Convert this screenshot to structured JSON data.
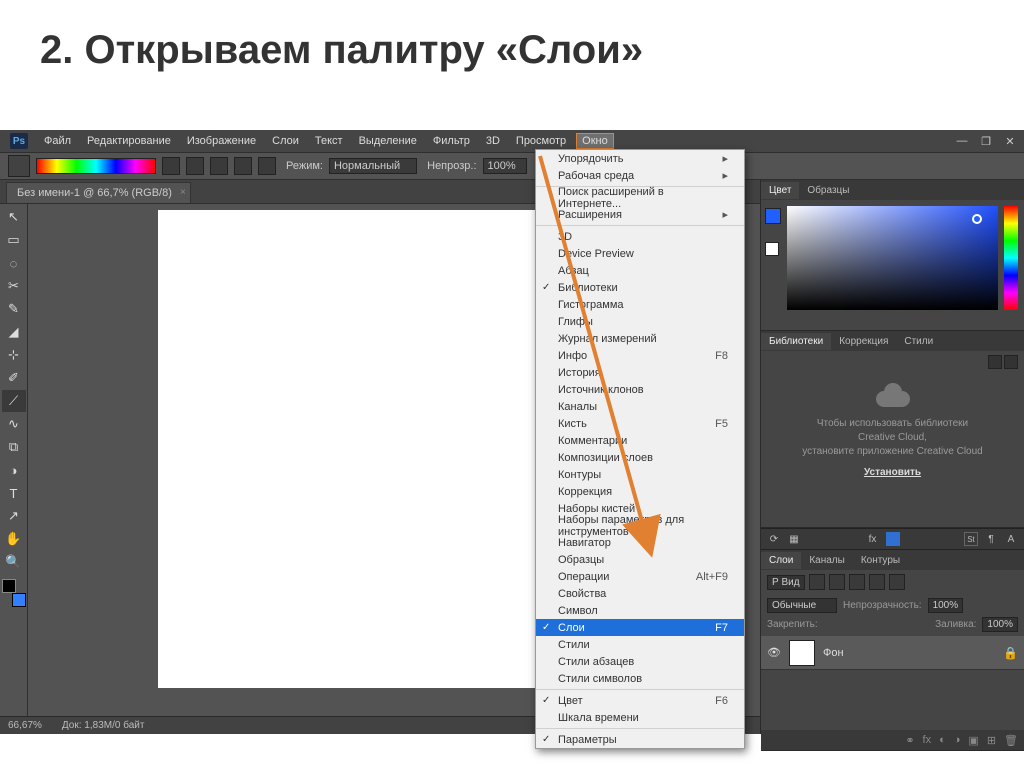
{
  "slide": {
    "title": "2. Открываем палитру «Слои»"
  },
  "menubar": {
    "logo": "Ps",
    "items": [
      "Файл",
      "Редактирование",
      "Изображение",
      "Слои",
      "Текст",
      "Выделение",
      "Фильтр",
      "3D",
      "Просмотр",
      "Окно"
    ],
    "active": "Окно"
  },
  "options": {
    "mode_label": "Режим:",
    "mode_value": "Нормальный",
    "opacity_label": "Непрозр.:",
    "opacity_value": "100%"
  },
  "doc": {
    "tab": "Без имени-1 @ 66,7% (RGB/8)"
  },
  "status": {
    "zoom": "66,67%",
    "docinfo": "Док: 1,83М/0 байт"
  },
  "panels": {
    "color_tabs": [
      "Цвет",
      "Образцы"
    ],
    "lib_tabs": [
      "Библиотеки",
      "Коррекция",
      "Стили"
    ],
    "lib_message1": "Чтобы использовать библиотеки",
    "lib_message2": "Creative Cloud,",
    "lib_message3": "установите приложение Creative Cloud",
    "lib_link": "Установить",
    "layer_tabs": [
      "Слои",
      "Каналы",
      "Контуры"
    ],
    "layer_filter_label": "Р Вид",
    "blend_mode": "Обычные",
    "opacity_label": "Непрозрачность:",
    "opacity_value": "100%",
    "lock_label": "Закрепить:",
    "fill_label": "Заливка:",
    "fill_value": "100%",
    "layer_name": "Фон"
  },
  "dropdown": [
    {
      "label": "Упорядочить",
      "sub": true
    },
    {
      "label": "Рабочая среда",
      "sub": true
    },
    {
      "sep": true
    },
    {
      "label": "Поиск расширений в Интернете..."
    },
    {
      "label": "Расширения",
      "sub": true
    },
    {
      "sep": true
    },
    {
      "label": "3D"
    },
    {
      "label": "Device Preview"
    },
    {
      "label": "Абзац"
    },
    {
      "label": "Библиотеки",
      "checked": true
    },
    {
      "label": "Гистограмма"
    },
    {
      "label": "Глифы"
    },
    {
      "label": "Журнал измерений"
    },
    {
      "label": "Инфо",
      "shortcut": "F8"
    },
    {
      "label": "История"
    },
    {
      "label": "Источник клонов"
    },
    {
      "label": "Каналы"
    },
    {
      "label": "Кисть",
      "shortcut": "F5"
    },
    {
      "label": "Комментарии"
    },
    {
      "label": "Композиции слоев"
    },
    {
      "label": "Контуры"
    },
    {
      "label": "Коррекция"
    },
    {
      "label": "Наборы кистей"
    },
    {
      "label": "Наборы параметров для инструментов"
    },
    {
      "label": "Навигатор"
    },
    {
      "label": "Образцы"
    },
    {
      "label": "Операции",
      "shortcut": "Alt+F9"
    },
    {
      "label": "Свойства"
    },
    {
      "label": "Символ"
    },
    {
      "label": "Слои",
      "shortcut": "F7",
      "hl": true,
      "checked": true
    },
    {
      "label": "Стили"
    },
    {
      "label": "Стили абзацев"
    },
    {
      "label": "Стили символов"
    },
    {
      "sep": true
    },
    {
      "label": "Цвет",
      "shortcut": "F6",
      "checked": true
    },
    {
      "label": "Шкала времени"
    },
    {
      "sep": true
    },
    {
      "label": "Параметры",
      "checked": true
    }
  ],
  "tools": [
    "↖",
    "▭",
    "◌",
    "✂",
    "✎",
    "◢",
    "⊹",
    "✐",
    "⟋",
    "∿",
    "⧉",
    "◑",
    "T",
    "↗",
    "✋",
    "🔍"
  ]
}
